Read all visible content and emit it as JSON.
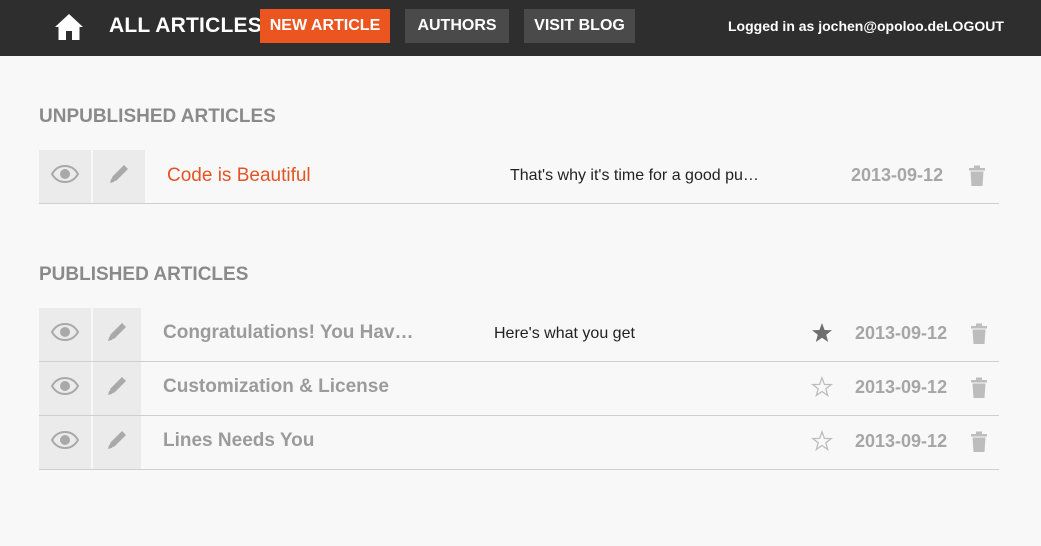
{
  "topbar": {
    "home_icon": "home-icon",
    "title": "ALL ARTICLES",
    "nav": {
      "new_article": "NEW ARTICLE",
      "authors": "AUTHORS",
      "visit_blog": "VISIT BLOG"
    },
    "logged_in": "Logged in as jochen@opoloo.de",
    "logout": "LOGOUT",
    "colors": {
      "bar": "#2e2e2e",
      "accent": "#ea5520",
      "nav_button": "#4a4a4a"
    }
  },
  "unpublished": {
    "title": "UNPUBLISHED ARTICLES",
    "rows": [
      {
        "title": "Code is Beautiful",
        "excerpt": "That's why it's time for a good pu…",
        "date": "2013-09-12"
      }
    ]
  },
  "published": {
    "title": "PUBLISHED ARTICLES",
    "rows": [
      {
        "title": "Congratulations! You Hav…",
        "excerpt": "Here's what you get",
        "date": "2013-09-12",
        "starred": true
      },
      {
        "title": "Customization & License",
        "excerpt": "",
        "date": "2013-09-12",
        "starred": false
      },
      {
        "title": "Lines Needs You",
        "excerpt": "",
        "date": "2013-09-12",
        "starred": false
      }
    ]
  },
  "icons": {
    "view": "eye-icon",
    "edit": "pencil-icon",
    "delete": "trash-icon",
    "star_filled": "star-filled-icon",
    "star_empty": "star-outline-icon"
  }
}
